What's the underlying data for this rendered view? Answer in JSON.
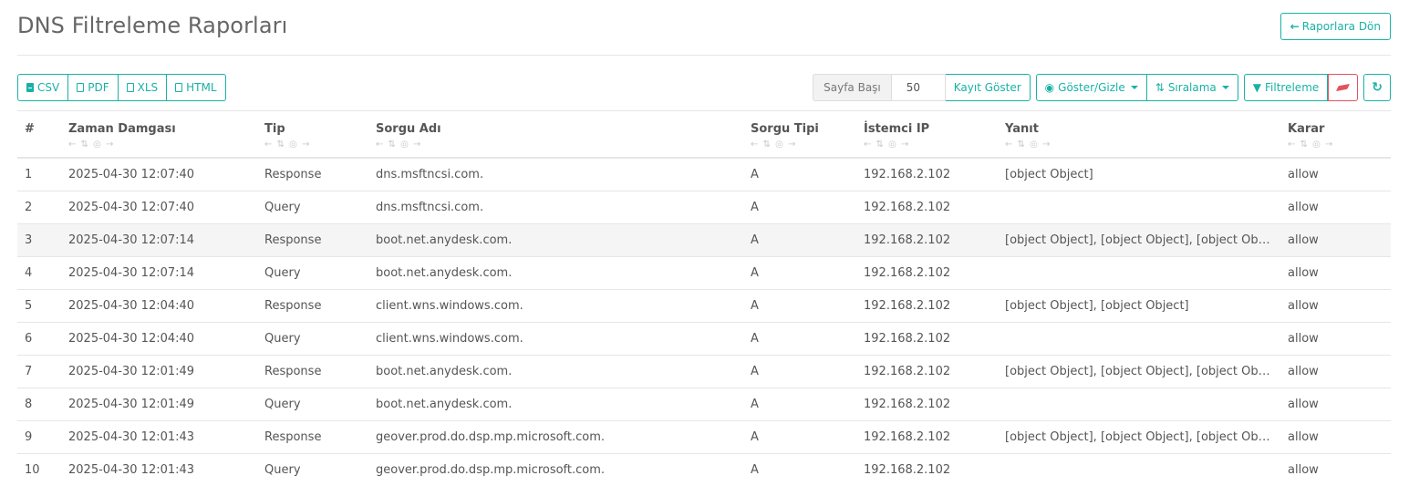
{
  "page": {
    "title": "DNS Filtreleme Raporları",
    "back_button": "Raporlara Dön"
  },
  "toolbar": {
    "export": [
      "CSV",
      "PDF",
      "XLS",
      "HTML"
    ],
    "page_size_label": "Sayfa Başı",
    "page_size_value": "50",
    "show_records": "Kayıt Göster",
    "show_hide": "Göster/Gizle",
    "sorting": "Sıralama",
    "filtering": "Filtreleme"
  },
  "table": {
    "headers": [
      "#",
      "Zaman Damgası",
      "Tip",
      "Sorgu Adı",
      "Sorgu Tipi",
      "İstemci IP",
      "Yanıt",
      "Karar"
    ],
    "rows": [
      [
        "1",
        "2025-04-30 12:07:40",
        "Response",
        "dns.msftncsi.com.",
        "A",
        "192.168.2.102",
        "[object Object]",
        "allow"
      ],
      [
        "2",
        "2025-04-30 12:07:40",
        "Query",
        "dns.msftncsi.com.",
        "A",
        "192.168.2.102",
        "",
        "allow"
      ],
      [
        "3",
        "2025-04-30 12:07:14",
        "Response",
        "boot.net.anydesk.com.",
        "A",
        "192.168.2.102",
        "[object Object], [object Object], [object Object],...",
        "allow"
      ],
      [
        "4",
        "2025-04-30 12:07:14",
        "Query",
        "boot.net.anydesk.com.",
        "A",
        "192.168.2.102",
        "",
        "allow"
      ],
      [
        "5",
        "2025-04-30 12:04:40",
        "Response",
        "client.wns.windows.com.",
        "A",
        "192.168.2.102",
        "[object Object], [object Object]",
        "allow"
      ],
      [
        "6",
        "2025-04-30 12:04:40",
        "Query",
        "client.wns.windows.com.",
        "A",
        "192.168.2.102",
        "",
        "allow"
      ],
      [
        "7",
        "2025-04-30 12:01:49",
        "Response",
        "boot.net.anydesk.com.",
        "A",
        "192.168.2.102",
        "[object Object], [object Object], [object Object],...",
        "allow"
      ],
      [
        "8",
        "2025-04-30 12:01:49",
        "Query",
        "boot.net.anydesk.com.",
        "A",
        "192.168.2.102",
        "",
        "allow"
      ],
      [
        "9",
        "2025-04-30 12:01:43",
        "Response",
        "geover.prod.do.dsp.mp.microsoft.com.",
        "A",
        "192.168.2.102",
        "[object Object], [object Object], [object Object]",
        "allow"
      ],
      [
        "10",
        "2025-04-30 12:01:43",
        "Query",
        "geover.prod.do.dsp.mp.microsoft.com.",
        "A",
        "192.168.2.102",
        "",
        "allow"
      ]
    ]
  },
  "colors": {
    "accent": "#18b2a5",
    "danger": "#e5525f"
  }
}
